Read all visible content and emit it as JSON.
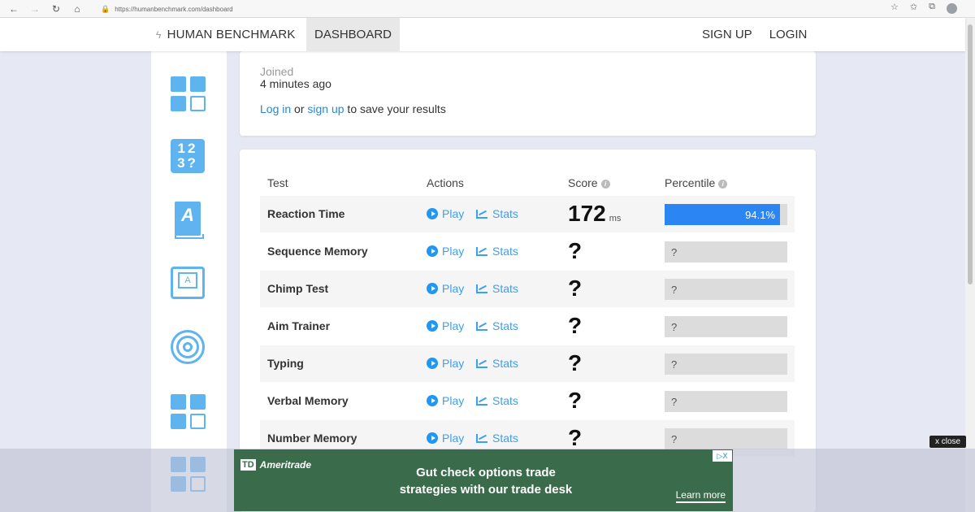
{
  "browser": {
    "url": "https://humanbenchmark.com/dashboard",
    "back_glyph": "←",
    "forward_glyph": "→",
    "reload_glyph": "↻",
    "home_glyph": "⌂"
  },
  "header": {
    "brand": "HUMAN BENCHMARK",
    "active_tab": "DASHBOARD",
    "signup": "SIGN UP",
    "login": "LOGIN"
  },
  "sidebar": {
    "icons": [
      "dashboard-grid-icon",
      "number-memory-icon",
      "verbal-book-icon",
      "typing-keyboard-icon",
      "aim-target-icon",
      "dashboard-grid-icon",
      "dashboard-grid-icon"
    ],
    "number_icon_text": "12\n3?",
    "book_icon_text": "A",
    "key_icon_text": "A"
  },
  "profile": {
    "joined_label": "Joined",
    "joined_value": "4 minutes ago",
    "login_link": "Log in",
    "or_text": " or ",
    "signup_link": "sign up",
    "save_text": " to save your results"
  },
  "table": {
    "columns": {
      "test": "Test",
      "actions": "Actions",
      "score": "Score",
      "percentile": "Percentile"
    },
    "play_label": "Play",
    "stats_label": "Stats",
    "rows": [
      {
        "name": "Reaction Time",
        "score": "172",
        "unit": "ms",
        "percentile_label": "94.1%",
        "percentile_value": 0.941
      },
      {
        "name": "Sequence Memory",
        "score": "?",
        "unit": "",
        "percentile_label": "?",
        "percentile_value": null
      },
      {
        "name": "Chimp Test",
        "score": "?",
        "unit": "",
        "percentile_label": "?",
        "percentile_value": null
      },
      {
        "name": "Aim Trainer",
        "score": "?",
        "unit": "",
        "percentile_label": "?",
        "percentile_value": null
      },
      {
        "name": "Typing",
        "score": "?",
        "unit": "",
        "percentile_label": "?",
        "percentile_value": null
      },
      {
        "name": "Verbal Memory",
        "score": "?",
        "unit": "",
        "percentile_label": "?",
        "percentile_value": null
      },
      {
        "name": "Number Memory",
        "score": "?",
        "unit": "",
        "percentile_label": "?",
        "percentile_value": null
      }
    ]
  },
  "ad": {
    "brand": "Ameritrade",
    "brand_mark": "TD",
    "headline_1": "Gut check options trade",
    "headline_2": "strategies with our trade desk",
    "cta": "Learn more",
    "choices": "▷X",
    "close": "x close"
  },
  "colors": {
    "accent": "#2b86f3",
    "link": "#2b87d1",
    "icon": "#5fb4ef",
    "page_bg": "#e6e8f3",
    "ad_bg": "#3a6b4b"
  }
}
